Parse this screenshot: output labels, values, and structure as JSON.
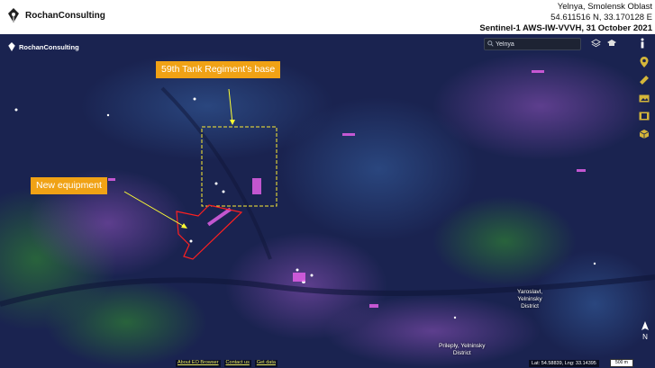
{
  "brand": {
    "name": "RochanConsulting",
    "map_watermark": "RochanConsulting"
  },
  "header": {
    "location": "Yelnya, Smolensk Oblast",
    "coordinates": "54.611516 N, 33.170128 E",
    "sensor_date": "Sentinel-1 AWS-IW-VVVH, 31 October 2021"
  },
  "search": {
    "value": "Yelnya"
  },
  "toolbar_icons": [
    "layers-icon",
    "graduation-cap-icon",
    "info-icon",
    "pin-icon",
    "ruler-icon",
    "image-icon",
    "film-icon",
    "cube-icon"
  ],
  "callouts": {
    "base": "59th Tank Regiment’s base",
    "equipment": "New equipment"
  },
  "places": {
    "yaroslavl": "Yaroslavl,\nYelninsky\nDistrict",
    "prileply": "Prileply, Yelninsky\nDistrict"
  },
  "footer": {
    "about": "About EO Browser",
    "contact": "Contact us",
    "get_data": "Get data",
    "latlng": "Lat: 54.58839, Lng: 33.14395",
    "scale": "500 m"
  },
  "colors": {
    "callout_bg": "#f0a215",
    "callout_arrow": "#ffff33",
    "base_box": "#ffee33",
    "equipment_outline": "#ff2020"
  }
}
